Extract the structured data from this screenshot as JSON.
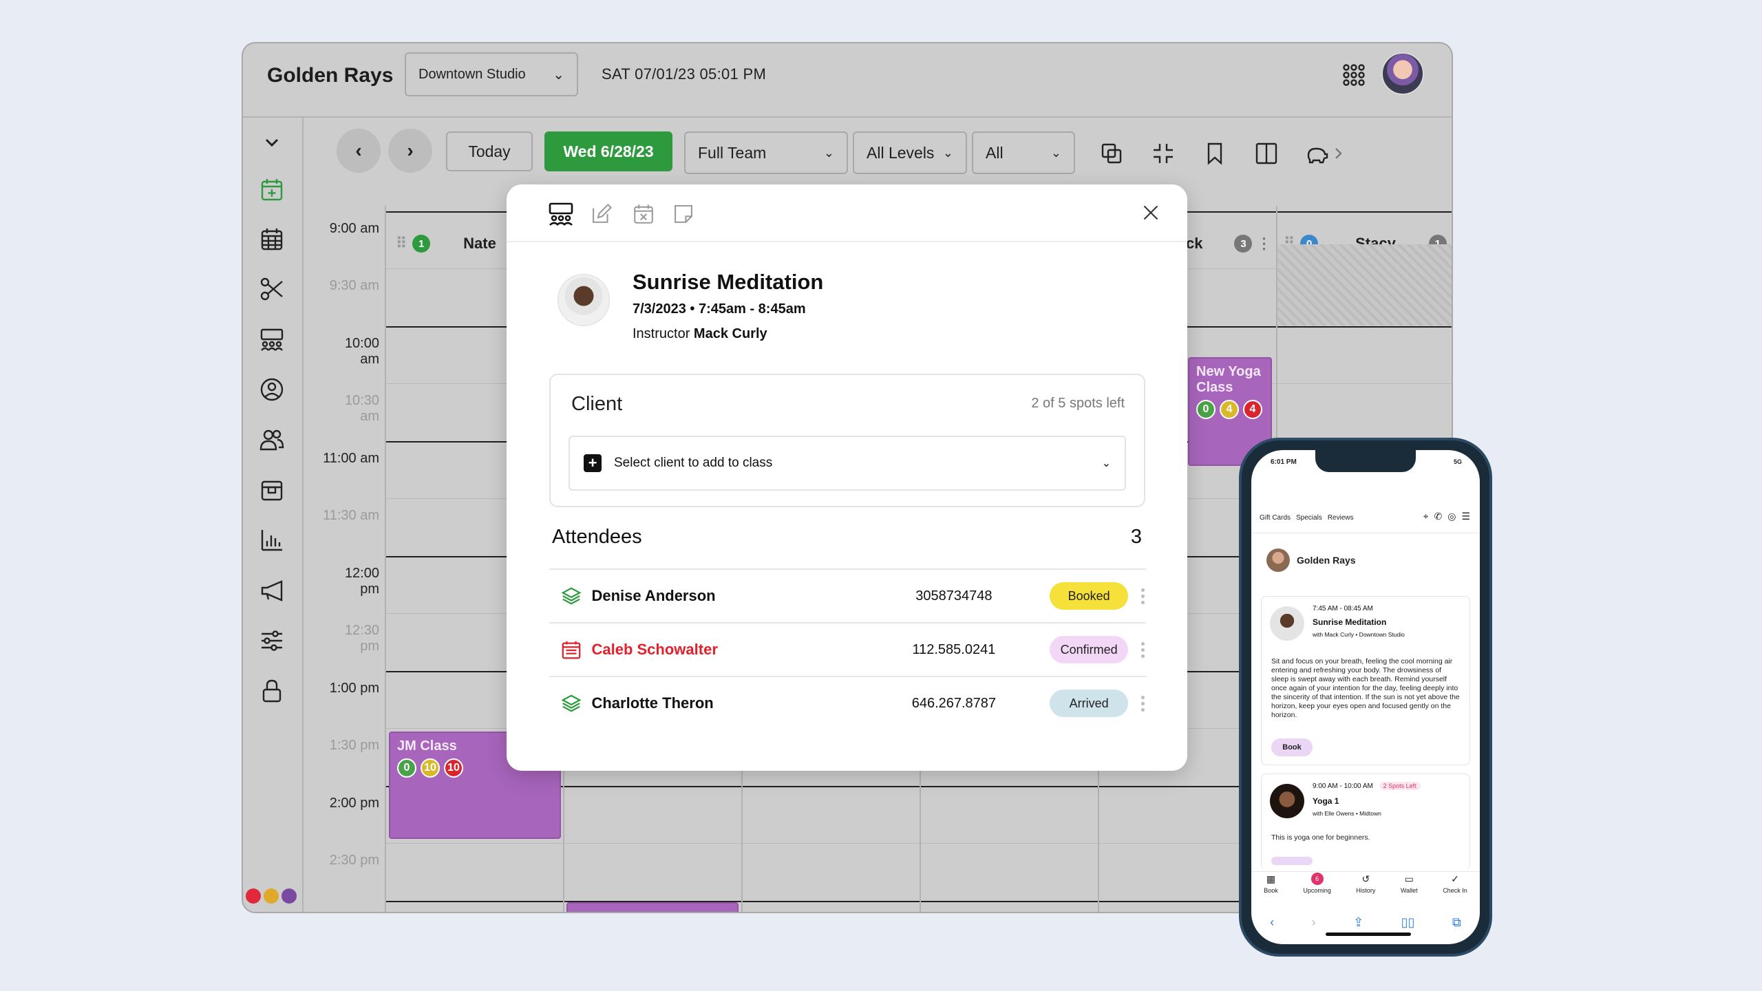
{
  "app": {
    "brand": "Golden Rays",
    "location": "Downtown Studio",
    "datetime": "SAT 07/01/23   05:01 PM"
  },
  "toolbar": {
    "prev": "‹",
    "next": "›",
    "today": "Today",
    "current_date": "Wed 6/28/23",
    "team_select": "Full Team",
    "levels_select": "All Levels",
    "filter_select": "All"
  },
  "calendar": {
    "times": [
      "9:00 am",
      "9:30 am",
      "10:00 am",
      "10:30 am",
      "11:00 am",
      "11:30 am",
      "12:00 pm",
      "12:30 pm",
      "1:00 pm",
      "1:30 pm",
      "2:00 pm",
      "2:30 pm"
    ],
    "columns": [
      {
        "name": "Nate",
        "left_badge": "1",
        "right_badge": ""
      },
      {
        "name": "ck",
        "left_badge": "",
        "right_badge": "3"
      },
      {
        "name": "Stacy",
        "left_badge": "0",
        "right_badge": "1"
      }
    ],
    "events": [
      {
        "title": "JM Class",
        "badges": [
          "0",
          "10",
          "10"
        ]
      },
      {
        "title": "New Yoga Class",
        "badges": [
          "0",
          "4",
          "4"
        ]
      }
    ]
  },
  "modal": {
    "class_title": "Sunrise Meditation",
    "class_date": "7/3/2023 • 7:45am - 8:45am",
    "instructor_prefix": "Instructor",
    "instructor_name": "Mack Curly",
    "client_label": "Client",
    "spots_left": "2 of 5 spots left",
    "select_client_placeholder": "Select client to add to class",
    "attendees_label": "Attendees",
    "attendees_count": "3",
    "attendees": [
      {
        "name": "Denise Anderson",
        "phone": "3058734748",
        "status": "Booked",
        "status_color": "#f5e13a"
      },
      {
        "name": "Caleb Schowalter",
        "phone": "112.585.0241",
        "status": "Confirmed",
        "status_color": "#f3d7f7"
      },
      {
        "name": "Charlotte Theron",
        "phone": "646.267.8787",
        "status": "Arrived",
        "status_color": "#cfe3ea"
      }
    ]
  },
  "phone": {
    "status_time": "6:01 PM",
    "status_right": "5G",
    "nav_links": [
      "Gift Cards",
      "Specials",
      "Reviews"
    ],
    "brand": "Golden Rays",
    "card1": {
      "time": "7:45 AM - 08:45 AM",
      "title": "Sunrise Meditation",
      "sub": "with Mack Curly • Downtown Studio",
      "desc": "Sit and focus on your breath, feeling the cool morning air entering and refreshing your body. The drowsiness of sleep is swept away with each breath. Remind yourself once again of your intention for the day, feeling deeply into the sincerity of that intention. If the sun is not yet above the horizon, keep your eyes open and focused gently on the horizon.",
      "book": "Book"
    },
    "card2": {
      "time": "9:00 AM - 10:00 AM",
      "spots": "2 Spots Left",
      "title": "Yoga 1",
      "sub": "with Elle Owens • Midtown",
      "desc": "This is yoga one for beginners."
    },
    "tabs": [
      "Book",
      "Upcoming",
      "History",
      "Wallet",
      "Check In"
    ],
    "upcoming_badge": "6"
  },
  "colors": {
    "accent_green": "#2e9a3e",
    "event_purple": "#a765bb",
    "red": "#e3202b"
  }
}
